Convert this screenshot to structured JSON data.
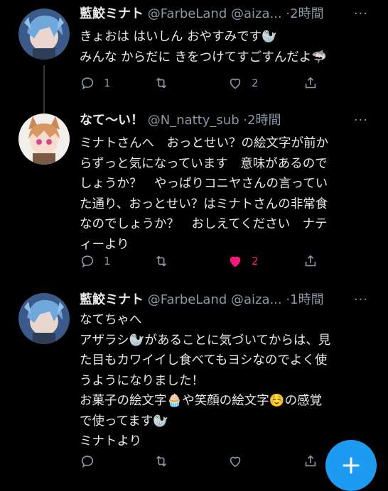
{
  "colors": {
    "background": "#000000",
    "text": "#e7e9ea",
    "muted": "#8b98a5",
    "like": "#f91880",
    "accent": "#1d9bf0"
  },
  "tweets": [
    {
      "name": "藍鮫ミナト",
      "handle": "@FarbeLand @aiza...",
      "time": "·2時間",
      "lines": [
        "きょおは はいしん おやすみです🦭",
        "みんな からだに きをつけてすごすんだよ🦈"
      ],
      "reply_count": "1",
      "retweet_count": "",
      "like_count": "2",
      "liked": false
    },
    {
      "name": "なて〜い！",
      "handle": "@N_natty_sub",
      "time": "·2時間",
      "lines": [
        "ミナトさんへ　おっとせい？の絵文字が前か",
        "らずっと気になっています　意味があるので",
        "しょうか？　やっぱりコニヤさんの言ってい",
        "た通り、おっとせい？はミナトさんの非常食",
        "なのでしょうか？　おしえてください　ナテ",
        "ィーより"
      ],
      "reply_count": "1",
      "retweet_count": "",
      "like_count": "2",
      "liked": true
    },
    {
      "name": "藍鮫ミナト",
      "handle": "@FarbeLand @aiza...",
      "time": "·1時間",
      "lines": [
        "なてちゃへ",
        "アザラシ🦭があることに気づいてからは、見",
        "た目もカワイイし食べてもヨシなのでよく使",
        "うようになりました！",
        "お菓子の絵文字🧁や笑顔の絵文字☺️の感覚",
        "で使ってます🦭",
        "ミナトより"
      ],
      "reply_count": "",
      "retweet_count": "",
      "like_count": "",
      "liked": false
    }
  ],
  "more_label": "···",
  "icons": [
    "reply-icon",
    "retweet-icon",
    "like-icon",
    "share-icon",
    "compose-icon"
  ]
}
